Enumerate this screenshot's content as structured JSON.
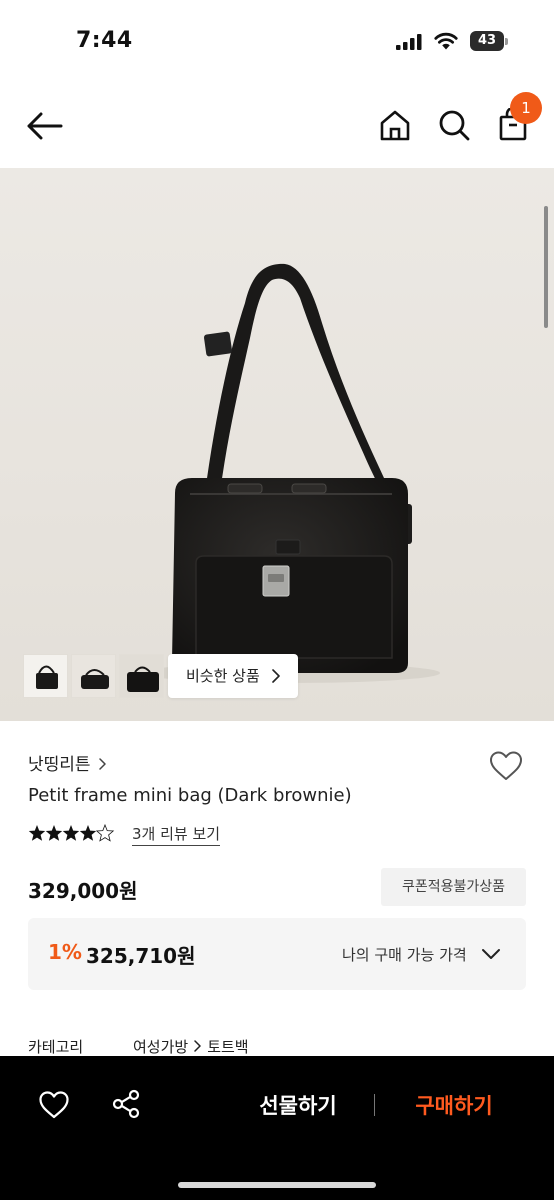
{
  "status_bar": {
    "time": "7:44",
    "battery": "43"
  },
  "nav": {
    "back_icon": "arrow-left",
    "home_icon": "home",
    "search_icon": "search",
    "bag_icon": "shopping-bag",
    "cart_count": "1",
    "badge_color": "#f05a18"
  },
  "gallery": {
    "similar_label": "비슷한 상품"
  },
  "product": {
    "brand": "낫띵리튼",
    "name": "Petit frame mini bag (Dark brownie)",
    "rating": 4.5,
    "review_link": "3개 리뷰 보기",
    "price": "329,000원",
    "coupon_label": "쿠폰적용불가상품",
    "discount": {
      "percent": "1%",
      "price": "325,710원",
      "label": "나의 구매 가능 가격"
    },
    "category": {
      "label": "카테고리",
      "level1": "여성가방",
      "level2": "토트백"
    }
  },
  "actions": {
    "gift_label": "선물하기",
    "buy_label": "구매하기",
    "buy_color": "#ff5a1f"
  }
}
